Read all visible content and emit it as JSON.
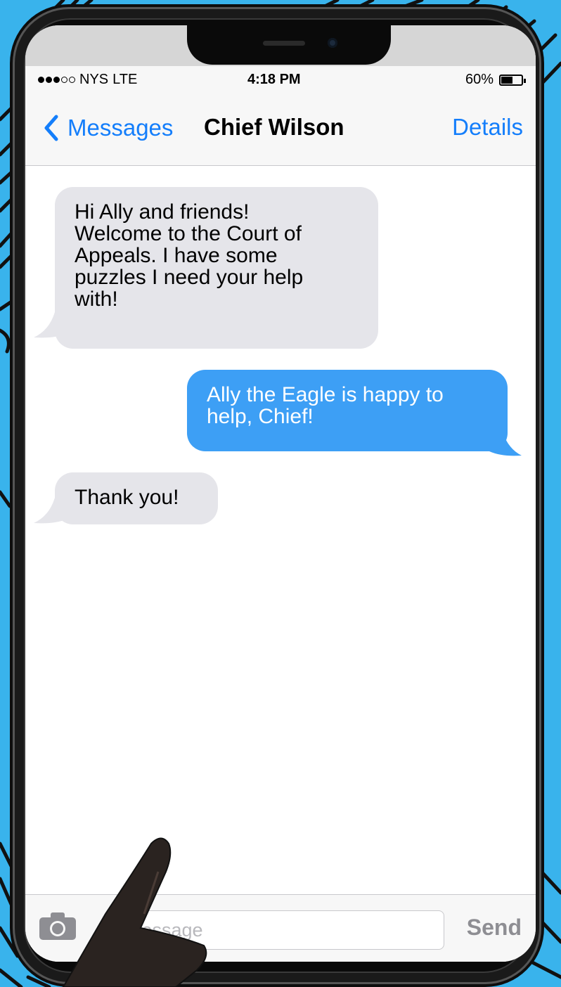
{
  "status_bar": {
    "carrier": "NYS",
    "network": "LTE",
    "time": "4:18 PM",
    "battery_text": "60%",
    "battery_level": 0.6,
    "signal_bars_filled": 3,
    "signal_bars_total": 5
  },
  "nav": {
    "back_label": "Messages",
    "title": "Chief Wilson",
    "details_label": "Details"
  },
  "messages": [
    {
      "direction": "incoming",
      "lines": [
        "Hi Ally and friends!",
        "Welcome to the Court of",
        "Appeals. I have some",
        "puzzles I need your help",
        "with!"
      ]
    },
    {
      "direction": "outgoing",
      "lines": [
        "Ally the Eagle is happy to",
        "help, Chief!"
      ]
    },
    {
      "direction": "incoming",
      "lines": [
        "Thank you!"
      ]
    }
  ],
  "input": {
    "placeholder": "iMessage",
    "send_label": "Send"
  },
  "icons": {
    "back": "chevron-left-icon",
    "camera": "camera-icon",
    "battery": "battery-icon",
    "signal": "signal-dots-icon"
  },
  "colors": {
    "background": "#39b3ec",
    "accent_blue": "#147efb",
    "outgoing_bubble": "#3d9ff5",
    "incoming_bubble": "#e5e5ea"
  }
}
